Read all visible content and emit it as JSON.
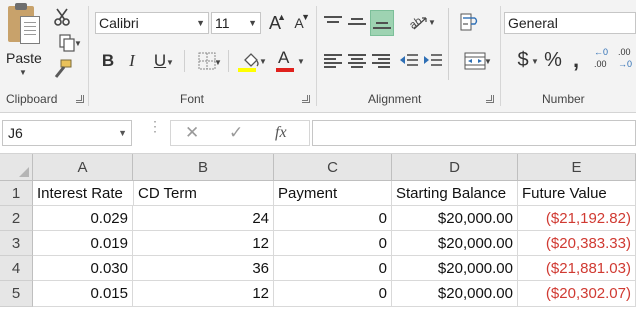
{
  "ribbon": {
    "clipboard": {
      "label": "Clipboard",
      "paste_label": "Paste",
      "icons": [
        "paste-icon",
        "cut-icon",
        "copy-icon",
        "format-painter-icon"
      ]
    },
    "font": {
      "label": "Font",
      "font_name": "Calibri",
      "font_size": "11",
      "grow_font": "A",
      "shrink_font": "A",
      "bold": "B",
      "italic": "I",
      "underline": "U",
      "font_color_letter": "A",
      "highlight_color": "#ffff00",
      "font_color": "#e0211d"
    },
    "alignment": {
      "label": "Alignment"
    },
    "number": {
      "label": "Number",
      "format": "General",
      "currency": "$",
      "percent": "%",
      "comma": ",",
      "increase_decimal": ".00",
      "decrease_decimal": ".00"
    }
  },
  "formula_bar": {
    "name_box": "J6",
    "cancel": "✕",
    "enter": "✓",
    "fx": "fx",
    "formula": ""
  },
  "sheet": {
    "columns": [
      "A",
      "B",
      "C",
      "D",
      "E"
    ],
    "rows": [
      {
        "num": "1",
        "cells": [
          "Interest Rate",
          "CD Term",
          "Payment",
          "Starting Balance",
          "Future Value"
        ]
      },
      {
        "num": "2",
        "cells": [
          "0.029",
          "24",
          "0",
          "$20,000.00",
          "($21,192.82)"
        ]
      },
      {
        "num": "3",
        "cells": [
          "0.019",
          "12",
          "0",
          "$20,000.00",
          "($20,383.33)"
        ]
      },
      {
        "num": "4",
        "cells": [
          "0.030",
          "36",
          "0",
          "$20,000.00",
          "($21,881.03)"
        ]
      },
      {
        "num": "5",
        "cells": [
          "0.015",
          "12",
          "0",
          "$20,000.00",
          "($20,302.07)"
        ]
      }
    ],
    "negative_color": "#d03a32"
  }
}
